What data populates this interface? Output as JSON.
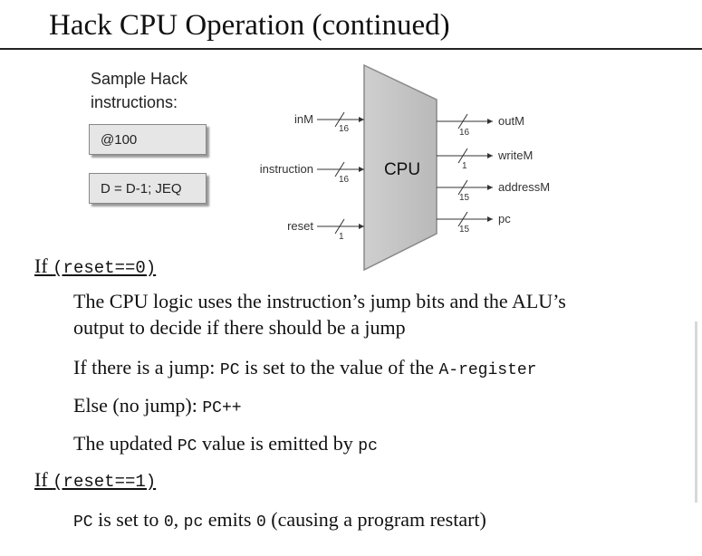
{
  "title": "Hack CPU Operation (continued)",
  "samples": {
    "label_line1": "Sample Hack",
    "label_line2": "instructions:",
    "instr1": "@100",
    "instr2": "D = D-1; JEQ"
  },
  "diagram": {
    "cpu_label": "CPU",
    "inputs": [
      {
        "name": "inM",
        "width": "16"
      },
      {
        "name": "instruction",
        "width": "16"
      },
      {
        "name": "reset",
        "width": "1"
      }
    ],
    "outputs": [
      {
        "name": "outM",
        "width": "16"
      },
      {
        "name": "writeM",
        "width": "1"
      },
      {
        "name": "addressM",
        "width": "15"
      },
      {
        "name": "pc",
        "width": "15"
      }
    ]
  },
  "cond0": {
    "prefix": "If ",
    "code": "(reset==0)"
  },
  "cond0_body": {
    "line1": "The CPU logic uses the instruction’s jump bits and the ALU’s",
    "line2": "output to decide if there should be a jump",
    "jump_a": "If there is a jump: ",
    "jump_b": "PC",
    "jump_c": " is set to the value of the ",
    "jump_d": "A-register",
    "else_a": "Else (no jump): ",
    "else_b": "PC++",
    "upd_a": "The updated ",
    "upd_b": "PC",
    "upd_c": " value is emitted by ",
    "upd_d": "pc"
  },
  "cond1": {
    "prefix": "If ",
    "code": "(reset==1)"
  },
  "cond1_body": {
    "a": "PC",
    "b": " is set to ",
    "c": "0",
    "d": ", ",
    "e": "pc",
    "f": " emits ",
    "g": "0",
    "h": " (causing a program restart)"
  }
}
